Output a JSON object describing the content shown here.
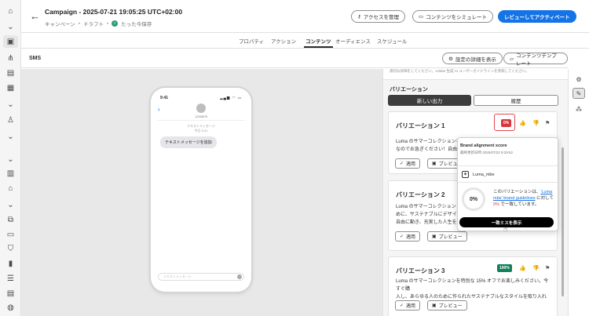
{
  "header": {
    "title": "Campaign - 2025-07-21 19:05:25 UTC+02:00",
    "breadcrumb": [
      "キャンペーン",
      "ドラフト"
    ],
    "save_status": "たった今保存",
    "manage_access": "アクセスを管理",
    "simulate": "コンテンツをシミュレート",
    "review_activate": "レビューしてアクティベート"
  },
  "tabs": [
    "プロパティ",
    "アクション",
    "コンテンツ",
    "オーディエンス",
    "スケジュール"
  ],
  "active_tab": "コンテンツ",
  "toolbar": {
    "channel": "SMS",
    "show_settings": "設定の詳細を表示",
    "content_template": "コンテンツテンプレート"
  },
  "phone": {
    "time": "9:41",
    "status_icons": "▂▄▆ ◠ ▭",
    "sender": "12345678",
    "meta_label": "テキストメッセージ",
    "meta_time": "今日 9:41",
    "message": "テキストメッセージを追加",
    "composer_placeholder": "テキストメッセージ"
  },
  "panel": {
    "top_note": "適切な評価をしてください。Adobe 生成 AI ユーザーガイドラインを参照してください。",
    "variations_heading": "バリエーション",
    "seg_new": "新しい出力",
    "seg_history": "履歴",
    "apply_label": "適用",
    "preview_label": "プレビュー",
    "variations": [
      {
        "title": "バリエーション 1",
        "score": "0%",
        "score_color": "#d7373f",
        "body": [
          "Luma のサマーコレクションを",
          "なのでお急ぎください！自由に"
        ]
      },
      {
        "title": "バリエーション 2",
        "score": "",
        "body": [
          "Luma のサマーコレクション",
          "めに、サステナブルにデザイン",
          "自由に動き、充実した人生を"
        ]
      },
      {
        "title": "バリエーション 3",
        "score": "100%",
        "score_color": "#12805c",
        "body": [
          "Luma のサマーコレクションを特別な 15% オフでお楽しみください。今すぐ購",
          "入し、あらゆる人のために作られたサステナブルなスタイルを取り入れましょ"
        ]
      }
    ]
  },
  "popover": {
    "title": "Brand alignment score",
    "updated": "最終更新日時 2025/07/22 9:29:52",
    "brand": "Luma_mbe",
    "score": "0%",
    "desc_1": "このバリエーションは、",
    "desc_link": "'Luma mbe' brand guidelines",
    "desc_2": " に対して ",
    "desc_pct": "0%",
    "desc_3": " で一致しています。",
    "show_button": "一致ミスを表示"
  }
}
